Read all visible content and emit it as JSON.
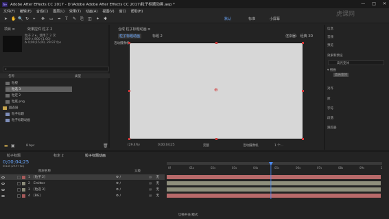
{
  "window": {
    "title": "Adobe After Effects CC 2017 - D:\\Adobe Adobe After Effects CC 2017\\粒子标题动画.aep *",
    "logo": "Ae",
    "minimize": "—",
    "maximize": "□",
    "close": "✕"
  },
  "menu": [
    "文件(F)",
    "编辑(E)",
    "合成(C)",
    "图层(L)",
    "效果(T)",
    "动画(A)",
    "视图(V)",
    "窗口",
    "帮助(H)"
  ],
  "workspaces": [
    "默认",
    "标准",
    "小屏幕"
  ],
  "project": {
    "tab": "项目 ≡",
    "effects_tab": "效果控件 粒子 2",
    "item_name": "粒子 2 ▾，使用了 2 次",
    "item_info1": "800 x 800 (1.00)",
    "item_info2": "Δ 0;00;15;00, 29.97 fps",
    "col_name": "名称",
    "col_type": "类型",
    "items": [
      {
        "label": "粒橙",
        "kind": "file"
      },
      {
        "label": "粒选 3",
        "kind": "file",
        "selected": true
      },
      {
        "label": "粒定 2",
        "kind": "file"
      },
      {
        "label": "粒底.png",
        "kind": "file"
      },
      {
        "label": "固态层",
        "kind": "folder"
      },
      {
        "label": "粒子标题",
        "kind": "comp"
      },
      {
        "label": "粒子标题动画",
        "kind": "comp"
      }
    ],
    "bpc": "8 bpc"
  },
  "composition": {
    "header": "合成 粒子标题动画 ≡",
    "tab_active": "粒子标题动画",
    "tab_other": "标题 2",
    "renderer": "渲染器： 经典 3D",
    "active_camera": "活动摄像机",
    "zoom": "(29.4%)",
    "timecode": "0;00;04;25",
    "quality": "完整",
    "camera": "活动摄像机",
    "views": "1 个..."
  },
  "right_panel": {
    "items": [
      "信息",
      "音频",
      "预览",
      "效果和预设",
      "跟踪",
      "对齐",
      "库",
      "字符",
      "段落",
      "跟踪器"
    ],
    "search": "高光变体",
    "tree_parent": "▾ 扭曲",
    "tree_child": "高光变体"
  },
  "timeline": {
    "tabs": [
      "粒子标题",
      "标定 2",
      "粒子标题动画"
    ],
    "timecode": "0;00;04;25",
    "fps": "00145 (29.97 fps)",
    "col_source": "图层名称",
    "col_parent": "父级",
    "time_labels": [
      "0f",
      "01s",
      "02s",
      "03s",
      "04s",
      "05s",
      "06s",
      "07s",
      "08s",
      "09s",
      "10s"
    ],
    "playhead_fraction": 0.49,
    "layers": [
      {
        "num": "1",
        "name": "[粒子 2]",
        "parent": "无",
        "bar_color": "#b86a6a",
        "label_color": "#a55a5a",
        "selected": true
      },
      {
        "num": "2",
        "name": "Emitter",
        "parent": "无",
        "bar_color": "#8f8f7c",
        "label_color": "#8c8c7a"
      },
      {
        "num": "3",
        "name": "[粒选 3]",
        "parent": "无",
        "bar_color": "#8f8f7c",
        "label_color": "#8c8c7a"
      },
      {
        "num": "4",
        "name": "[BG]",
        "parent": "无",
        "bar_color": "#b86a6a",
        "label_color": "#a55a5a"
      }
    ],
    "footer": "切换开关/模式"
  },
  "watermark": "虎课网"
}
